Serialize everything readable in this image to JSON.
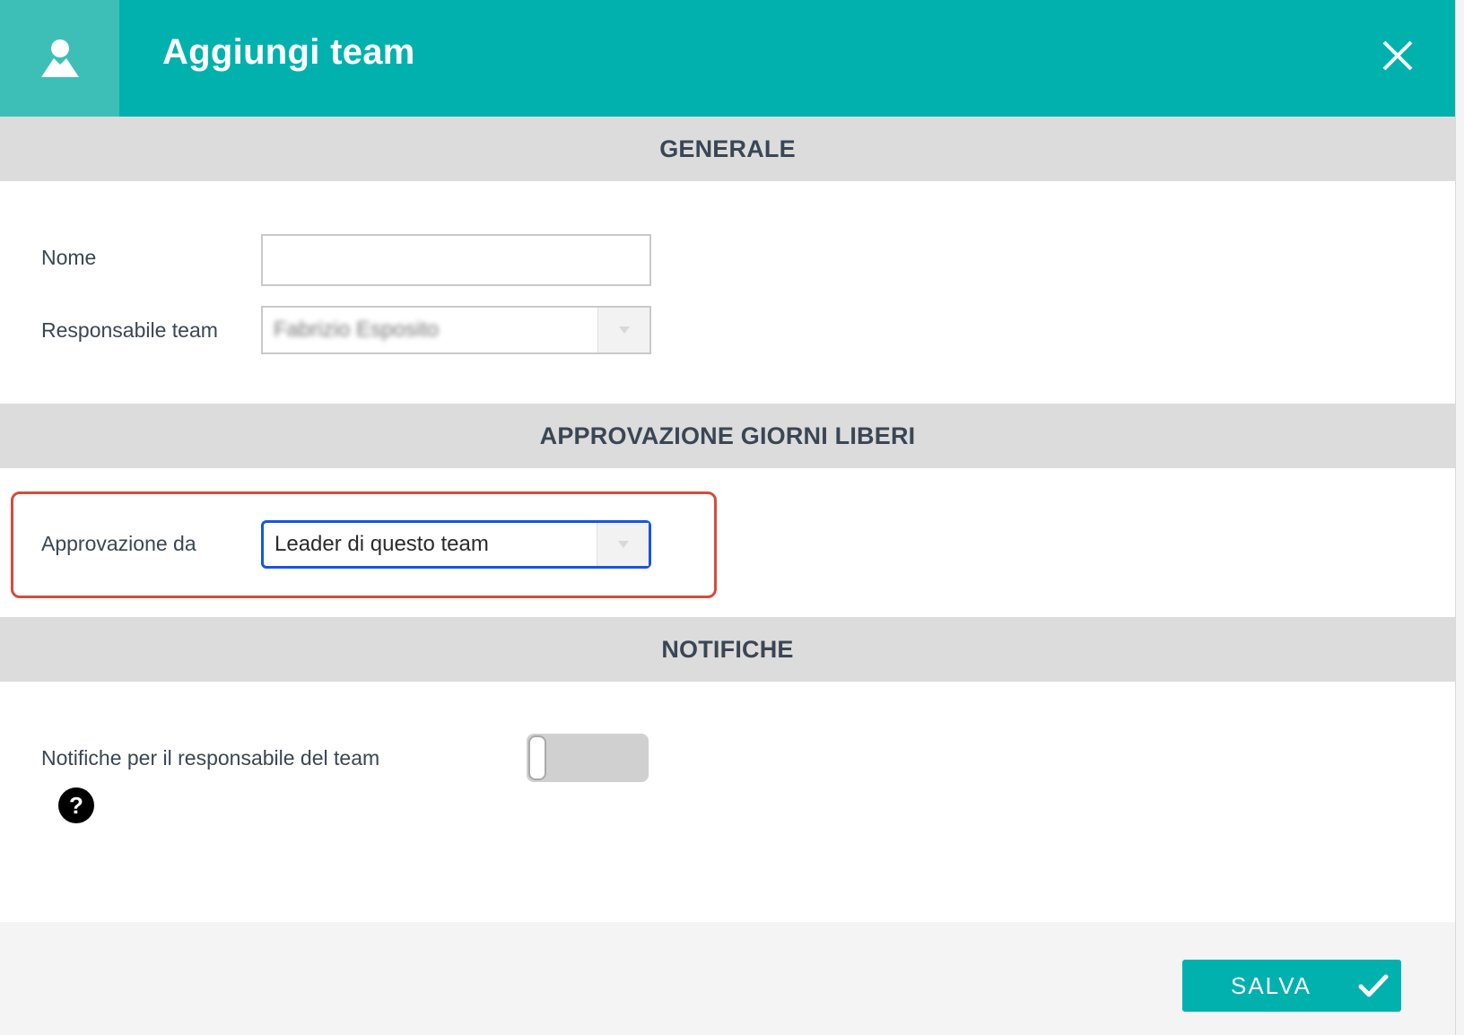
{
  "dialog": {
    "title": "Aggiungi team",
    "header_icon": "user-icon",
    "close_icon": "close-icon"
  },
  "sections": {
    "general": "GENERALE",
    "approval": "APPROVAZIONE GIORNI LIBERI",
    "notifications": "NOTIFICHE"
  },
  "form": {
    "name_label": "Nome",
    "name_value": "",
    "manager_label": "Responsabile team",
    "manager_value": "Fabrizio Esposito",
    "approval_label": "Approvazione da",
    "approval_value": "Leader di questo team",
    "notify_label": "Notifiche per il responsabile del team",
    "notify_enabled": false,
    "help_icon": "question-icon",
    "help_glyph": "?"
  },
  "footer": {
    "save_label": "SALVA",
    "save_icon": "checkmark-icon"
  },
  "colors": {
    "accent": "#00b1ae",
    "header_icon_bg": "#3dbfb8",
    "section_bar": "#dcdcdc",
    "focus_border": "#1457e0",
    "highlight_border": "#d94a3c"
  }
}
